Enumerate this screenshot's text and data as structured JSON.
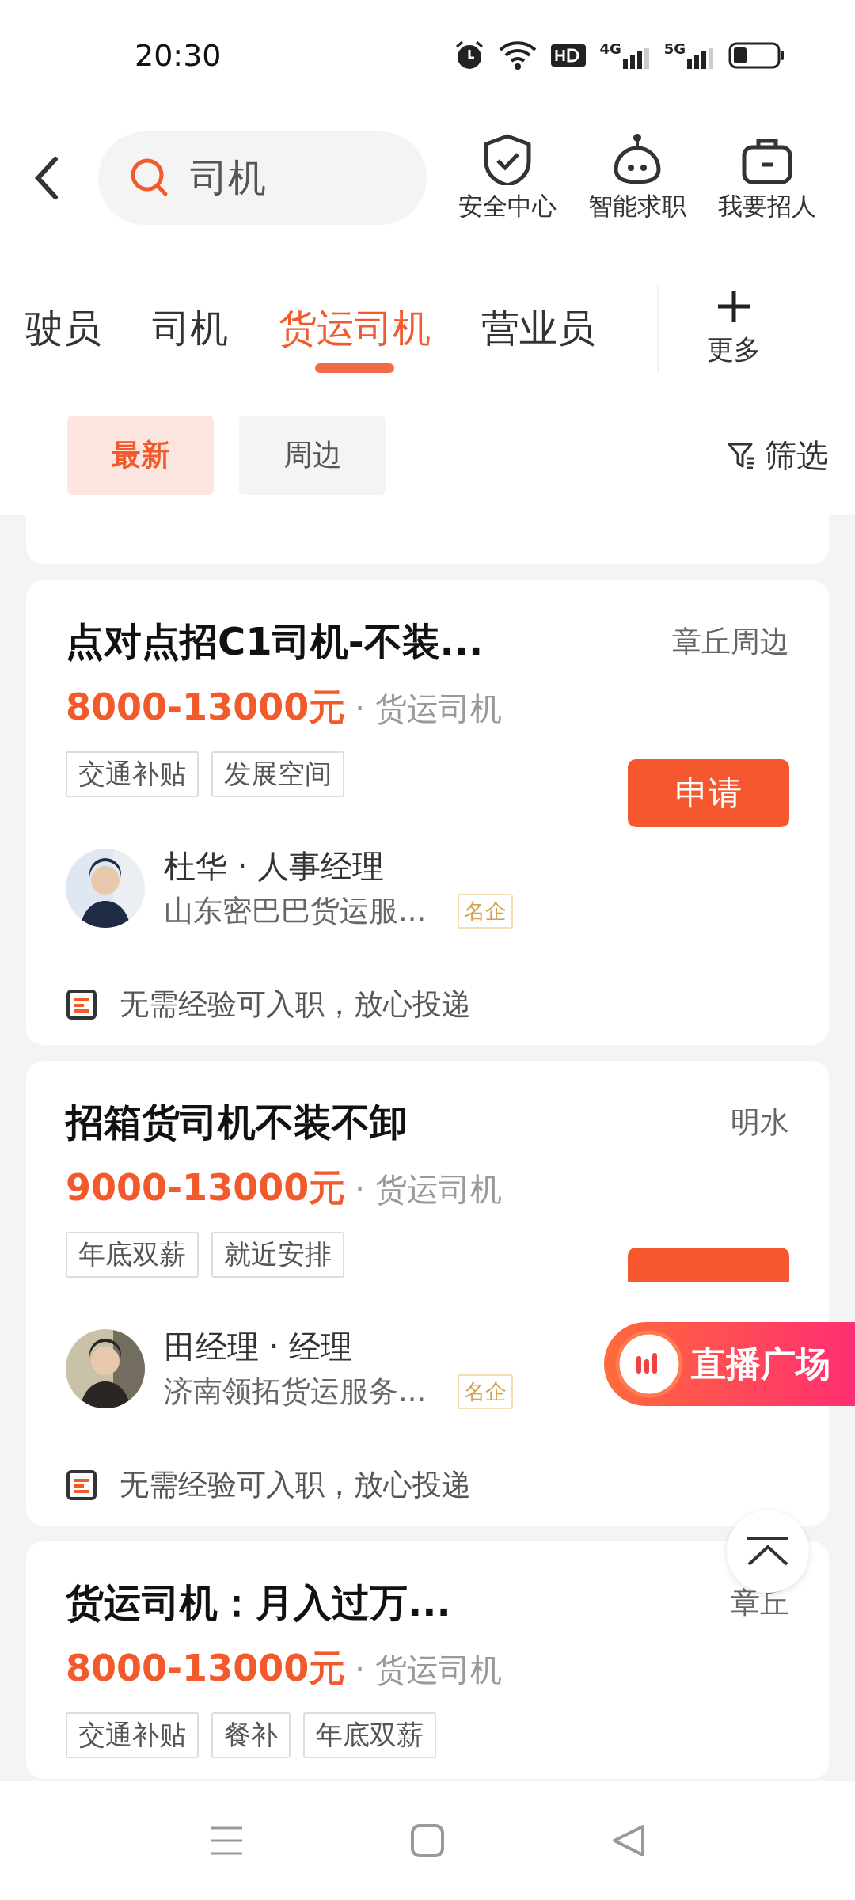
{
  "status_bar": {
    "time": "20:30",
    "networks": [
      "4G",
      "5G"
    ]
  },
  "header": {
    "search": {
      "value": "司机"
    },
    "actions": [
      {
        "label": "安全中心"
      },
      {
        "label": "智能求职"
      },
      {
        "label": "我要招人"
      }
    ]
  },
  "tabs": [
    {
      "label": "驶员",
      "selected": false
    },
    {
      "label": "司机",
      "selected": false
    },
    {
      "label": "货运司机",
      "selected": true
    },
    {
      "label": "营业员",
      "selected": false
    }
  ],
  "more_button": {
    "label": "更多"
  },
  "sort_chips": [
    {
      "label": "最新",
      "selected": true
    },
    {
      "label": "周边",
      "selected": false
    }
  ],
  "filter_button": {
    "label": "筛选"
  },
  "jobs": [
    {
      "title": "点对点招C1司机-不装...",
      "location": "章丘周边",
      "salary": "8000-13000元",
      "category": "· 货运司机",
      "tags": [
        "交通补贴",
        "发展空间"
      ],
      "apply": {
        "label": "申请",
        "covered": false
      },
      "recruiter": "杜华 · 人事经理",
      "company": "山东密巴巴货运服...",
      "badge": "名企",
      "note": "无需经验可入职，放心投递"
    },
    {
      "title": "招箱货司机不装不卸",
      "location": "明水",
      "salary": "9000-13000元",
      "category": "· 货运司机",
      "tags": [
        "年底双薪",
        "就近安排"
      ],
      "apply": {
        "covered": true
      },
      "recruiter": "田经理 · 经理",
      "company": "济南领拓货运服务...",
      "badge": "名企",
      "note": "无需经验可入职，放心投递"
    },
    {
      "title": "货运司机：月入过万...",
      "location": "章丘",
      "salary": "8000-13000元",
      "category": "· 货运司机",
      "tags": [
        "交通补贴",
        "餐补",
        "年底双薪"
      ]
    }
  ],
  "live_button": {
    "label": "直播广场"
  }
}
